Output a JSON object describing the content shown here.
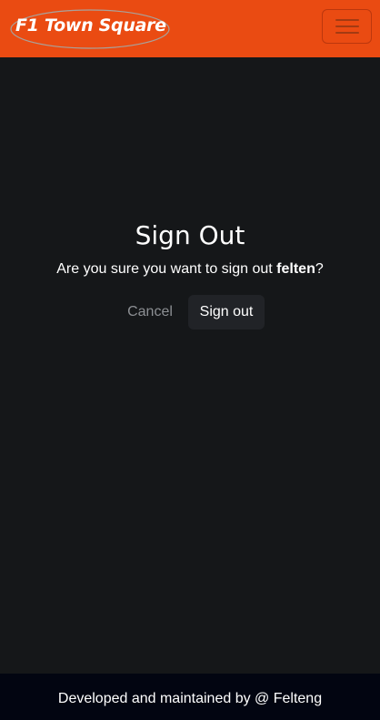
{
  "colors": {
    "navbar": "#ea4b12",
    "background": "#151719",
    "footer": "#020511",
    "signout_button": "#212327",
    "cancel_text": "#8c8f93"
  },
  "navbar": {
    "brand": "F1 Town Square",
    "menu_icon": "hamburger-menu-icon"
  },
  "main": {
    "title": "Sign Out",
    "prompt_prefix": "Are you sure you want to sign out ",
    "username": "felten",
    "prompt_suffix": "?",
    "cancel_label": "Cancel",
    "signout_label": "Sign out"
  },
  "footer": {
    "text": "Developed and maintained by @ Felteng"
  }
}
